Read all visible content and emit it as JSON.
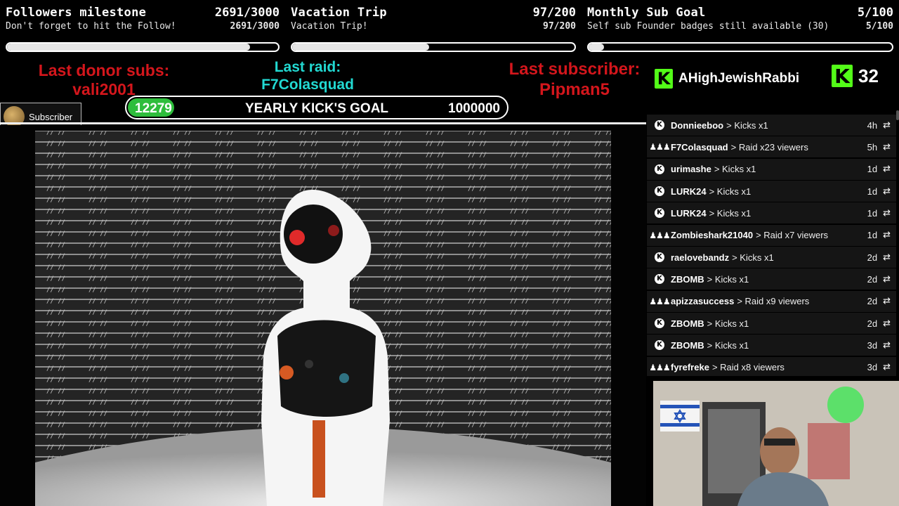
{
  "goals": [
    {
      "title": "Followers milestone",
      "count": "2691/3000",
      "subtitle": "Don't forget to hit the Follow!",
      "progress": 0.897
    },
    {
      "title": "Vacation Trip",
      "count": "97/200",
      "subtitle": "Vacation Trip!",
      "progress": 0.485
    },
    {
      "title": "Monthly Sub Goal",
      "count": "5/100",
      "subtitle": "Self sub Founder badges still available (30)",
      "progress": 0.05
    }
  ],
  "last_donor": {
    "label": "Last donor subs:",
    "name": "vali2001"
  },
  "last_raid": {
    "label": "Last raid:",
    "name": "F7Colasquad"
  },
  "last_subscriber": {
    "label": "Last subscriber:",
    "name": "Pipman5"
  },
  "kick_user": {
    "name": "AHighJewishRabbi",
    "logo_letter": "K"
  },
  "kick_count": {
    "value": "32",
    "logo_letter": "K"
  },
  "subscriber_chip": {
    "label": "Subscriber"
  },
  "yearly_goal": {
    "current": "12279",
    "label": "YEARLY KICK'S GOAL",
    "target": "1000000",
    "progress": 0.0123
  },
  "feed": [
    {
      "icon": "kick-icon",
      "name": "Donnieeboo",
      "action": "> Kicks x1",
      "time": "4h"
    },
    {
      "icon": "raid-icon",
      "name": "F7Colasquad",
      "action": "> Raid x23 viewers",
      "time": "5h"
    },
    {
      "icon": "kick-icon",
      "name": "urimashe",
      "action": "> Kicks x1",
      "time": "1d"
    },
    {
      "icon": "kick-icon",
      "name": "LURK24",
      "action": "> Kicks x1",
      "time": "1d"
    },
    {
      "icon": "kick-icon",
      "name": "LURK24",
      "action": "> Kicks x1",
      "time": "1d"
    },
    {
      "icon": "raid-icon",
      "name": "Zombieshark21040",
      "action": "> Raid x7 viewers",
      "time": "1d"
    },
    {
      "icon": "kick-icon",
      "name": "raelovebandz",
      "action": "> Kicks x1",
      "time": "2d"
    },
    {
      "icon": "kick-icon",
      "name": "ZBOMB",
      "action": "> Kicks x1",
      "time": "2d"
    },
    {
      "icon": "raid-icon",
      "name": "apizzasuccess",
      "action": "> Raid x9 viewers",
      "time": "2d"
    },
    {
      "icon": "kick-icon",
      "name": "ZBOMB",
      "action": "> Kicks x1",
      "time": "2d"
    },
    {
      "icon": "kick-icon",
      "name": "ZBOMB",
      "action": "> Kicks x1",
      "time": "3d"
    },
    {
      "icon": "raid-icon",
      "name": "fyrefreke",
      "action": "> Raid x8 viewers",
      "time": "3d"
    }
  ],
  "colors": {
    "kick_green": "#53fc18",
    "red": "#d4161c",
    "cyan": "#22d9d2",
    "pill_green": "#2ebd3c"
  }
}
